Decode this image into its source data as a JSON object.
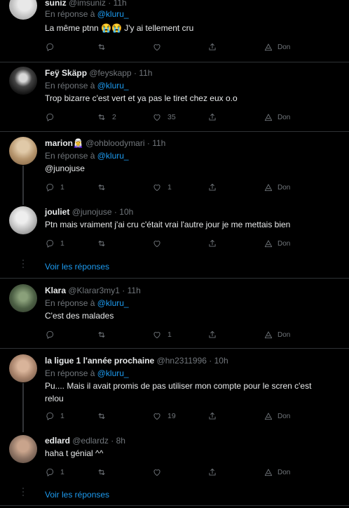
{
  "tweets": [
    {
      "name": "suniz",
      "handle": "@imsuniz",
      "time": "11h",
      "reply_prefix": "En réponse à",
      "reply_to": "@kluru_",
      "text": "La même ptnn 😭😭 J'y ai tellement cru",
      "replies": "",
      "retweets": "",
      "likes": "",
      "don": "Don"
    },
    {
      "name": "Feÿ Skäpp",
      "handle": "@feyskapp",
      "time": "11h",
      "reply_prefix": "En réponse à",
      "reply_to": "@kluru_",
      "text": "Trop bizarre c'est vert et ya pas le tiret chez eux o.o",
      "replies": "",
      "retweets": "2",
      "likes": "35",
      "don": "Don"
    },
    {
      "name": "marion🧝‍♀️",
      "handle": "@ohbloodymari",
      "time": "11h",
      "reply_prefix": "En réponse à",
      "reply_to": "@kluru_",
      "text": "@junojuse",
      "replies": "1",
      "retweets": "",
      "likes": "1",
      "don": "Don"
    },
    {
      "name": "jouliet",
      "handle": "@junojuse",
      "time": "10h",
      "reply_prefix": "",
      "reply_to": "",
      "text": "Ptn mais vraiment j'ai cru c'était vrai l'autre jour je me mettais bien",
      "replies": "1",
      "retweets": "",
      "likes": "",
      "don": "Don"
    },
    {
      "name": "Klara",
      "handle": "@Klarar3my1",
      "time": "11h",
      "reply_prefix": "En réponse à",
      "reply_to": "@kluru_",
      "text": "C'est des malades",
      "replies": "",
      "retweets": "",
      "likes": "1",
      "don": "Don"
    },
    {
      "name": "la ligue 1 l'année prochaine",
      "handle": "@hn2311996",
      "time": "10h",
      "reply_prefix": "En réponse à",
      "reply_to": "@kluru_",
      "text": "Pu.... Mais il avait promis de pas utiliser mon compte pour le scren c'est relou",
      "replies": "1",
      "retweets": "",
      "likes": "19",
      "don": "Don"
    },
    {
      "name": "edlard",
      "handle": "@edlardz",
      "time": "8h",
      "reply_prefix": "",
      "reply_to": "",
      "text": "haha t génial ^^",
      "replies": "1",
      "retweets": "",
      "likes": "",
      "don": "Don"
    }
  ],
  "show_replies_1": "Voir les réponses",
  "show_replies_2": "Voir les réponses",
  "dot": "·",
  "colors": {
    "background": "#000000",
    "text": "#e7e9ea",
    "muted": "#71767b",
    "accent": "#1d9bf0",
    "divider": "#2f3336"
  }
}
